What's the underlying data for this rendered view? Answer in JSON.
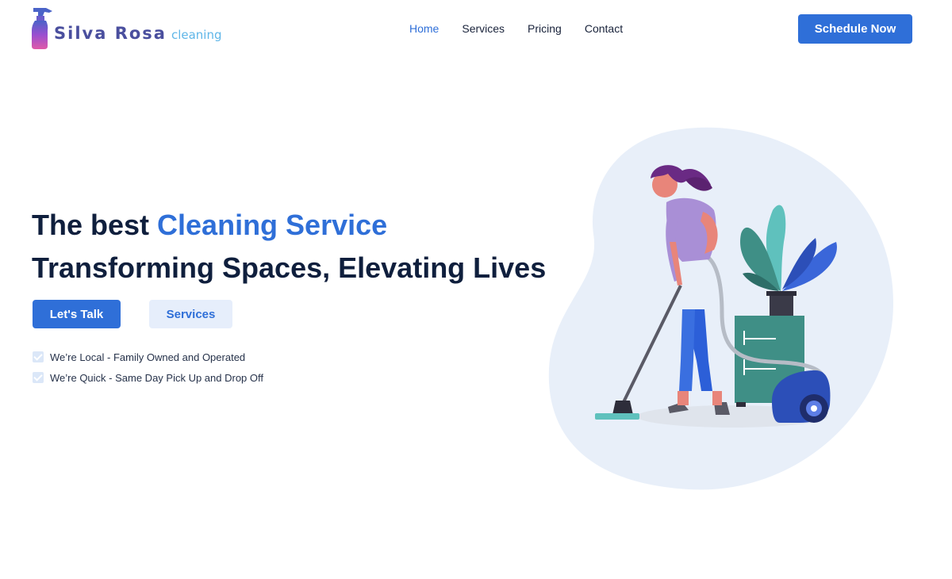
{
  "brand": {
    "name": "Silva Rosa",
    "sub": "cleaning"
  },
  "nav": {
    "items": [
      "Home",
      "Services",
      "Pricing",
      "Contact"
    ],
    "active": "Home"
  },
  "header": {
    "cta_label": "Schedule Now"
  },
  "hero": {
    "title_prefix": "The best ",
    "title_highlight": "Cleaning Service",
    "subtitle": "Transforming Spaces, Elevating Lives",
    "primary_label": "Let's Talk",
    "secondary_label": "Services",
    "features": [
      "We’re Local - Family Owned and Operated",
      "We’re Quick - Same Day Pick Up and Drop Off"
    ]
  },
  "colors": {
    "accent": "#2f6fd8",
    "heading": "#0f1f3d",
    "blob": "#e8eff9",
    "secondary_bg": "#e6eefb"
  },
  "icons": {
    "logo": "spray-bottle-icon",
    "check": "checkbox-check-icon"
  }
}
